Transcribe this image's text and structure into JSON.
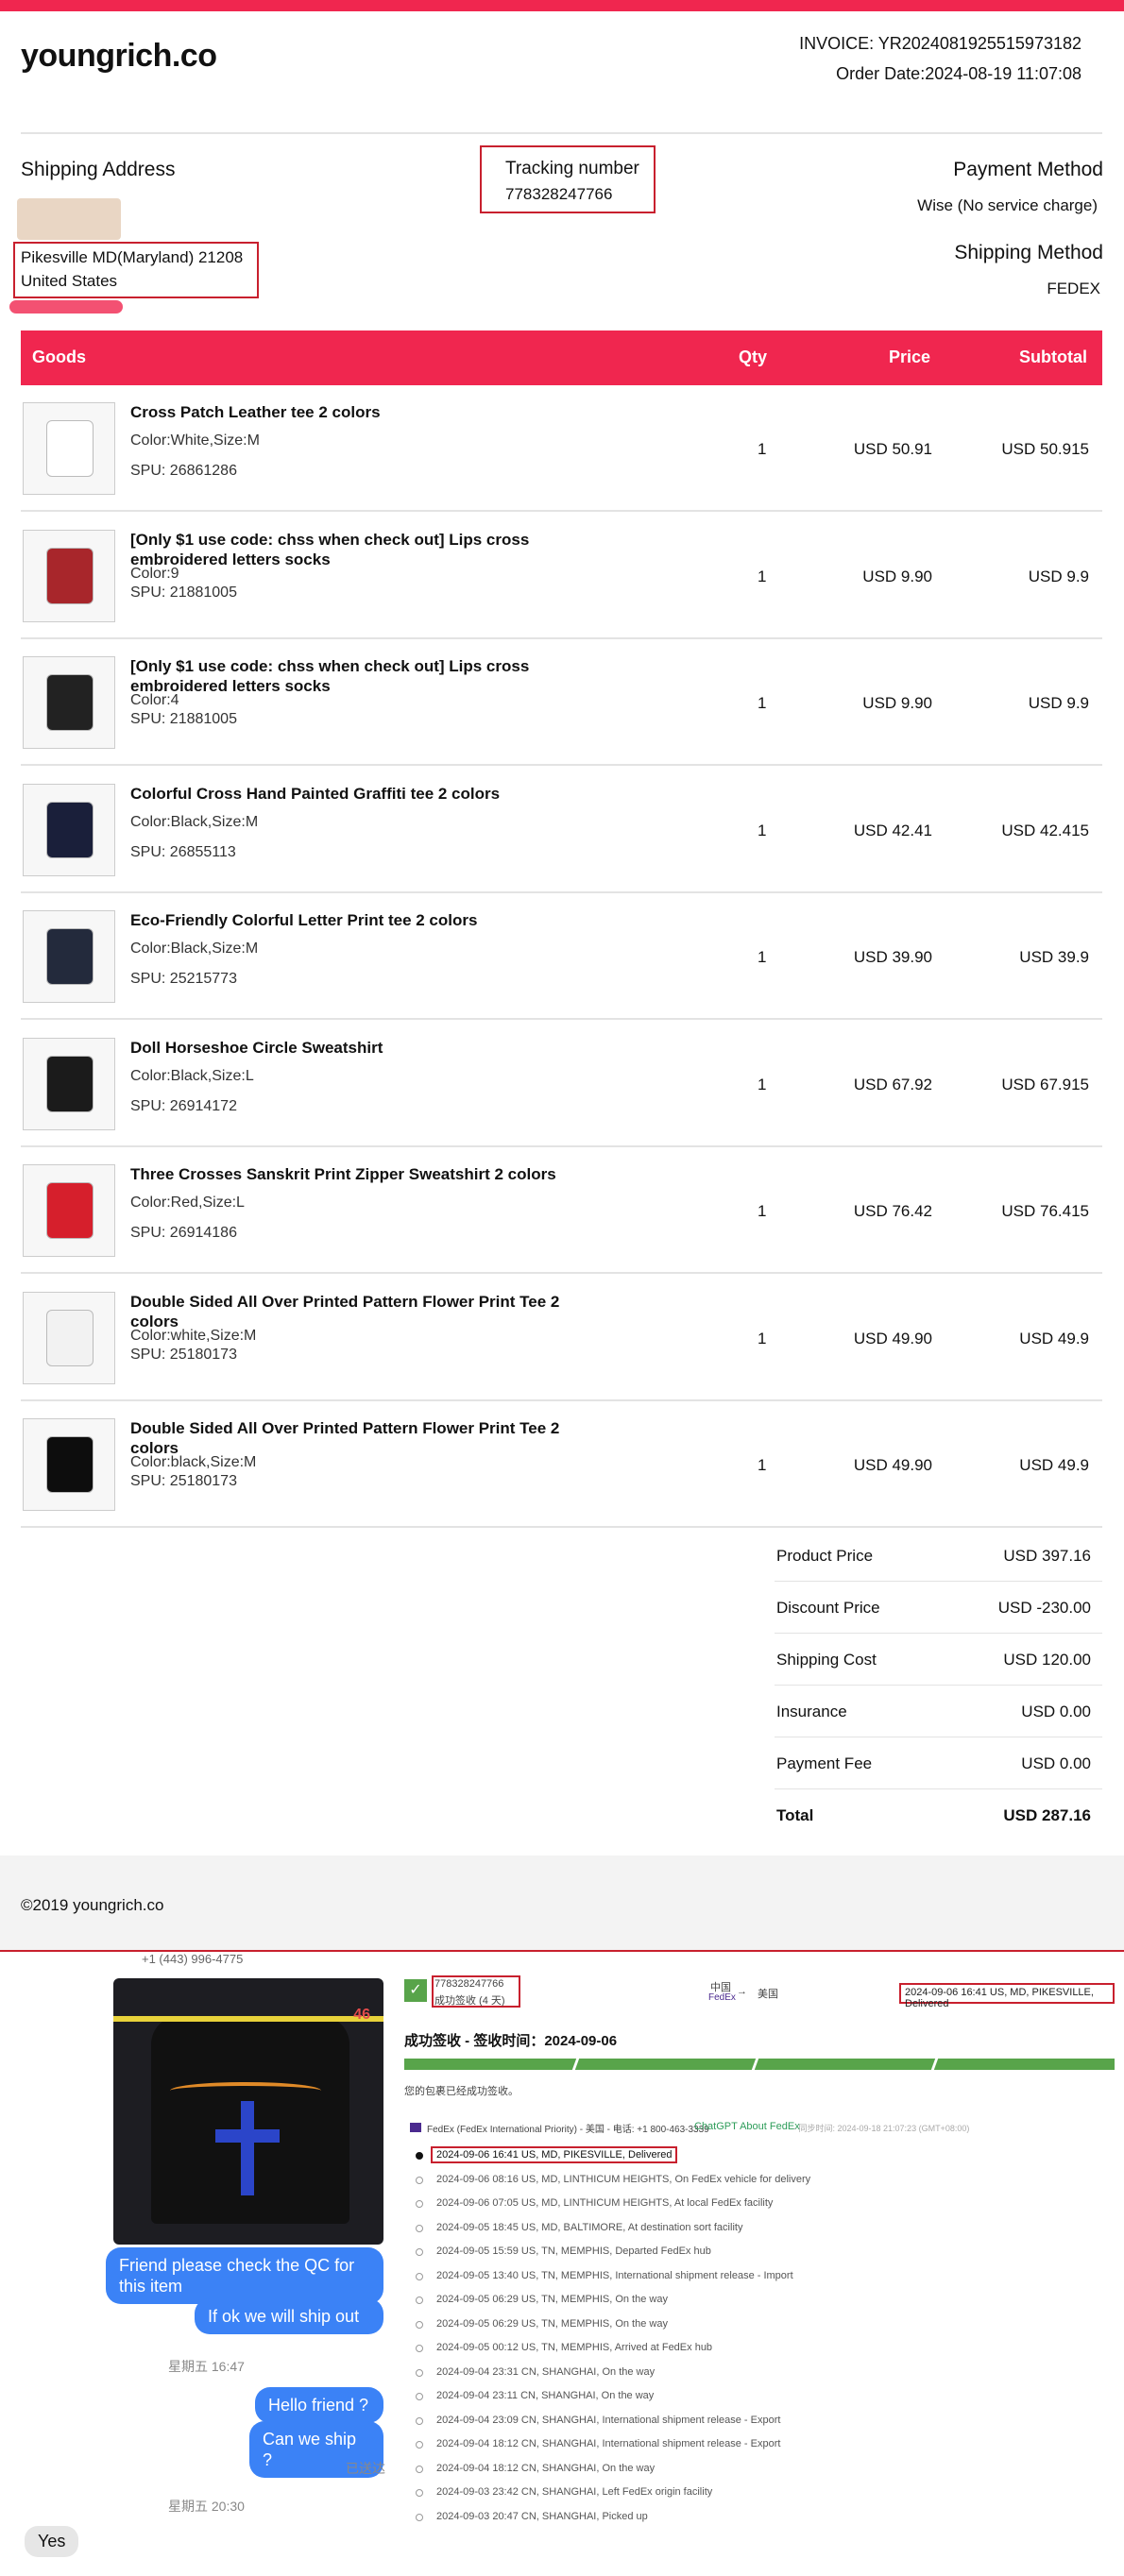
{
  "brand": "youngrich.co",
  "invoice": {
    "number_line": "INVOICE: YR2024081925515973182",
    "date_line": "Order Date:2024-08-19 11:07:08"
  },
  "shipping": {
    "label": "Shipping Address",
    "city": "Pikesville MD(Maryland) 21208",
    "country": "United States"
  },
  "tracking": {
    "label": "Tracking number",
    "value": "778328247766"
  },
  "payment": {
    "label": "Payment Method",
    "value": "Wise (No service charge)"
  },
  "shipping_method": {
    "label": "Shipping Method",
    "value": "FEDEX"
  },
  "goods_header": {
    "goods": "Goods",
    "qty": "Qty",
    "price": "Price",
    "subtotal": "Subtotal"
  },
  "items": [
    {
      "name": "Cross Patch Leather tee 2 colors",
      "attr": "Color:White,Size:M",
      "spu": "SPU: 26861286",
      "qty": "1",
      "price": "USD 50.91",
      "subtotal": "USD 50.915",
      "color": "#ffffff"
    },
    {
      "name": "[Only $1 use code: chss when check out] Lips cross embroidered letters socks",
      "attr": "Color:9",
      "spu": "SPU: 21881005",
      "qty": "1",
      "price": "USD 9.90",
      "subtotal": "USD 9.9",
      "color": "#a8262b"
    },
    {
      "name": "[Only $1 use code: chss when check out] Lips cross embroidered letters socks",
      "attr": "Color:4",
      "spu": "SPU: 21881005",
      "qty": "1",
      "price": "USD 9.90",
      "subtotal": "USD 9.9",
      "color": "#222222"
    },
    {
      "name": "Colorful Cross Hand Painted Graffiti tee 2 colors",
      "attr": "Color:Black,Size:M",
      "spu": "SPU: 26855113",
      "qty": "1",
      "price": "USD 42.41",
      "subtotal": "USD 42.415",
      "color": "#1a1f3a"
    },
    {
      "name": "Eco-Friendly Colorful Letter Print tee 2 colors",
      "attr": "Color:Black,Size:M",
      "spu": "SPU: 25215773",
      "qty": "1",
      "price": "USD 39.90",
      "subtotal": "USD 39.9",
      "color": "#232a3c"
    },
    {
      "name": "Doll Horseshoe Circle Sweatshirt",
      "attr": "Color:Black,Size:L",
      "spu": "SPU: 26914172",
      "qty": "1",
      "price": "USD 67.92",
      "subtotal": "USD 67.915",
      "color": "#1b1b1b"
    },
    {
      "name": "Three Crosses Sanskrit Print Zipper Sweatshirt 2 colors",
      "attr": "Color:Red,Size:L",
      "spu": "SPU: 26914186",
      "qty": "1",
      "price": "USD 76.42",
      "subtotal": "USD 76.415",
      "color": "#d61f2c"
    },
    {
      "name": "Double Sided All Over Printed Pattern Flower Print Tee 2 colors",
      "attr": "Color:white,Size:M",
      "spu": "SPU: 25180173",
      "qty": "1",
      "price": "USD 49.90",
      "subtotal": "USD 49.9",
      "color": "#f2f2f2"
    },
    {
      "name": "Double Sided All Over Printed Pattern Flower Print Tee 2 colors",
      "attr": "Color:black,Size:M",
      "spu": "SPU: 25180173",
      "qty": "1",
      "price": "USD 49.90",
      "subtotal": "USD 49.9",
      "color": "#0d0d0d"
    }
  ],
  "summary": [
    {
      "k": "Product Price",
      "v": "USD 397.16"
    },
    {
      "k": "Discount Price",
      "v": "USD -230.00"
    },
    {
      "k": "Shipping Cost",
      "v": "USD 120.00"
    },
    {
      "k": "Insurance",
      "v": "USD 0.00"
    },
    {
      "k": "Payment Fee",
      "v": "USD 0.00"
    },
    {
      "k": "Total",
      "v": "USD 287.16"
    }
  ],
  "footer": "©2019 youngrich.co",
  "chat": {
    "phone_partial": "+1 (443) 996-4775",
    "photo_tag": "46",
    "m1": "Friend please check the QC for this item",
    "m2": "If ok we will ship out",
    "t1": "星期五 16:47",
    "m3": "Hello friend ?",
    "m4": "Can we ship ?",
    "sent": "已送达",
    "t2": "星期五 20:30",
    "m5": "Yes"
  },
  "track": {
    "number": "778328247766",
    "status_short": "成功签收 (4 天)",
    "origin": "中国",
    "carrier": "FedEx",
    "dest": "美国",
    "latest": "2024-09-06 16:41 US, MD, PIKESVILLE, Delivered",
    "headline": "成功签收 - 签收时间：2024-09-06",
    "sub": "您的包裹已经成功签收。",
    "carrier_line": "FedEx (FedEx International Priority) - 美国 - 电话: +1 800-463-3339",
    "chatgpt": "ChatGPT About FedEx",
    "sync": "- 同步时间: 2024-09-18 21:07:23 (GMT+08:00)",
    "events": [
      "2024-09-06 16:41 US, MD, PIKESVILLE, Delivered",
      "2024-09-06 08:16 US, MD, LINTHICUM HEIGHTS, On FedEx vehicle for delivery",
      "2024-09-06 07:05 US, MD, LINTHICUM HEIGHTS, At local FedEx facility",
      "2024-09-05 18:45 US, MD, BALTIMORE, At destination sort facility",
      "2024-09-05 15:59 US, TN, MEMPHIS, Departed FedEx hub",
      "2024-09-05 13:40 US, TN, MEMPHIS, International shipment release - Import",
      "2024-09-05 06:29 US, TN, MEMPHIS, On the way",
      "2024-09-05 06:29 US, TN, MEMPHIS, On the way",
      "2024-09-05 00:12 US, TN, MEMPHIS, Arrived at FedEx hub",
      "2024-09-04 23:31 CN, SHANGHAI, On the way",
      "2024-09-04 23:11 CN, SHANGHAI, On the way",
      "2024-09-04 23:09 CN, SHANGHAI, International shipment release - Export",
      "2024-09-04 18:12 CN, SHANGHAI, International shipment release - Export",
      "2024-09-04 18:12 CN, SHANGHAI, On the way",
      "2024-09-03 23:42 CN, SHANGHAI, Left FedEx origin facility",
      "2024-09-03 20:47 CN, SHANGHAI, Picked up"
    ]
  },
  "colors": {
    "accent": "#f0264f",
    "highlight": "#c8202e",
    "chat_blue": "#3b82f6",
    "progress_green": "#58a44a"
  }
}
